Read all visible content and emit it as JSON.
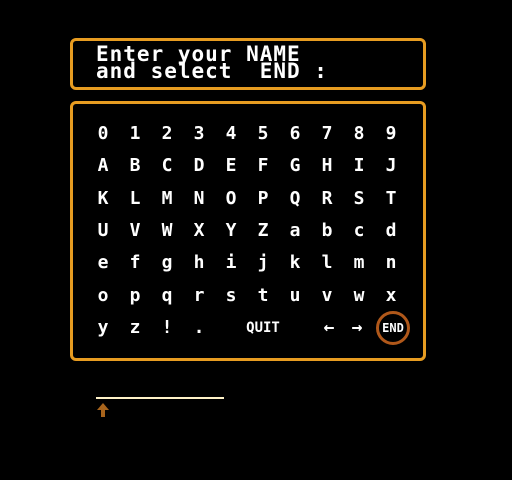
{
  "prompt": {
    "line1": "Enter your NAME",
    "line2": "and select  END :"
  },
  "keyboard": {
    "rows": [
      [
        "0",
        "1",
        "2",
        "3",
        "4",
        "5",
        "6",
        "7",
        "8",
        "9"
      ],
      [
        "A",
        "B",
        "C",
        "D",
        "E",
        "F",
        "G",
        "H",
        "I",
        "J"
      ],
      [
        "K",
        "L",
        "M",
        "N",
        "O",
        "P",
        "Q",
        "R",
        "S",
        "T"
      ],
      [
        "U",
        "V",
        "W",
        "X",
        "Y",
        "Z",
        "a",
        "b",
        "c",
        "d"
      ],
      [
        "e",
        "f",
        "g",
        "h",
        "i",
        "j",
        "k",
        "l",
        "m",
        "n"
      ],
      [
        "o",
        "p",
        "q",
        "r",
        "s",
        "t",
        "u",
        "v",
        "w",
        "x"
      ]
    ],
    "last_row": {
      "chars": [
        "y",
        "z",
        "!",
        "."
      ],
      "quit": "QUIT",
      "left": "←",
      "right": "→",
      "end": "END"
    },
    "selected": "END"
  },
  "name_entry": {
    "value": ""
  },
  "cursor_icon": "up-arrow-icon",
  "colors": {
    "frame": "#e79c21",
    "selection": "#b0581a",
    "text": "#ffffff",
    "cursor": "#a8641c"
  }
}
